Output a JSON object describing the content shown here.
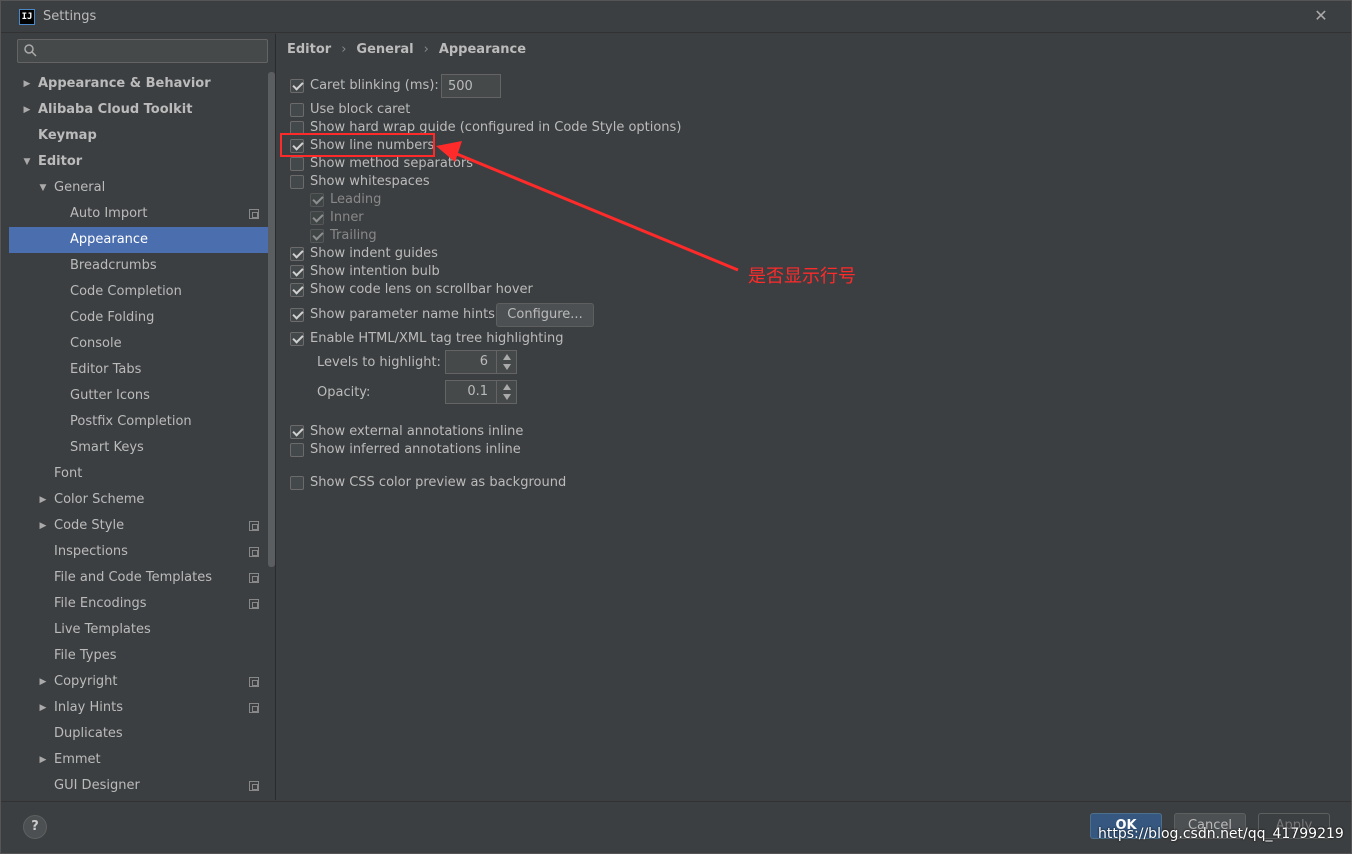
{
  "window": {
    "title": "Settings",
    "app_icon_text": "IJ",
    "close_glyph": "✕"
  },
  "search": {
    "placeholder": "",
    "value": ""
  },
  "sidebar": {
    "items": [
      {
        "label": "Appearance & Behavior",
        "arrow": "▶",
        "copy": false
      },
      {
        "label": "Alibaba Cloud Toolkit",
        "arrow": "▶",
        "copy": false
      },
      {
        "label": "Keymap",
        "arrow": "",
        "copy": false
      },
      {
        "label": "Editor",
        "arrow": "▼",
        "copy": false
      },
      {
        "label": "General",
        "arrow": "▼",
        "copy": false
      },
      {
        "label": "Auto Import",
        "arrow": "",
        "copy": true
      },
      {
        "label": "Appearance",
        "arrow": "",
        "copy": false,
        "selected": true
      },
      {
        "label": "Breadcrumbs",
        "arrow": "",
        "copy": false
      },
      {
        "label": "Code Completion",
        "arrow": "",
        "copy": false
      },
      {
        "label": "Code Folding",
        "arrow": "",
        "copy": false
      },
      {
        "label": "Console",
        "arrow": "",
        "copy": false
      },
      {
        "label": "Editor Tabs",
        "arrow": "",
        "copy": false
      },
      {
        "label": "Gutter Icons",
        "arrow": "",
        "copy": false
      },
      {
        "label": "Postfix Completion",
        "arrow": "",
        "copy": false
      },
      {
        "label": "Smart Keys",
        "arrow": "",
        "copy": false
      },
      {
        "label": "Font",
        "arrow": "",
        "copy": false
      },
      {
        "label": "Color Scheme",
        "arrow": "▶",
        "copy": false
      },
      {
        "label": "Code Style",
        "arrow": "▶",
        "copy": true
      },
      {
        "label": "Inspections",
        "arrow": "",
        "copy": true
      },
      {
        "label": "File and Code Templates",
        "arrow": "",
        "copy": true
      },
      {
        "label": "File Encodings",
        "arrow": "",
        "copy": true
      },
      {
        "label": "Live Templates",
        "arrow": "",
        "copy": false
      },
      {
        "label": "File Types",
        "arrow": "",
        "copy": false
      },
      {
        "label": "Copyright",
        "arrow": "▶",
        "copy": true
      },
      {
        "label": "Inlay Hints",
        "arrow": "▶",
        "copy": true
      },
      {
        "label": "Duplicates",
        "arrow": "",
        "copy": false
      },
      {
        "label": "Emmet",
        "arrow": "▶",
        "copy": false
      },
      {
        "label": "GUI Designer",
        "arrow": "",
        "copy": true
      }
    ]
  },
  "breadcrumb": {
    "part1": "Editor",
    "part2": "General",
    "part3": "Appearance",
    "sep": "›"
  },
  "settings": {
    "caret_blinking": {
      "label": "Caret blinking (ms):",
      "checked": true,
      "value": "500"
    },
    "use_block_caret": {
      "label": "Use block caret",
      "checked": false
    },
    "show_hard_wrap": {
      "label": "Show hard wrap guide (configured in Code Style options)",
      "checked": false
    },
    "show_line_numbers": {
      "label": "Show line numbers",
      "checked": true
    },
    "show_method_separators": {
      "label": "Show method separators",
      "checked": false
    },
    "show_whitespaces": {
      "label": "Show whitespaces",
      "checked": false
    },
    "leading": {
      "label": "Leading",
      "checked": true
    },
    "inner": {
      "label": "Inner",
      "checked": true
    },
    "trailing": {
      "label": "Trailing",
      "checked": true
    },
    "show_indent_guides": {
      "label": "Show indent guides",
      "checked": true
    },
    "show_intention_bulb": {
      "label": "Show intention bulb",
      "checked": true
    },
    "show_code_lens": {
      "label": "Show code lens on scrollbar hover",
      "checked": true
    },
    "show_param_hints": {
      "label": "Show parameter name hints",
      "checked": true,
      "button": "Configure..."
    },
    "enable_html_xml": {
      "label": "Enable HTML/XML tag tree highlighting",
      "checked": true
    },
    "levels_to_highlight": {
      "label": "Levels to highlight:",
      "value": "6"
    },
    "opacity": {
      "label": "Opacity:",
      "value": "0.1"
    },
    "show_external_annotations": {
      "label": "Show external annotations inline",
      "checked": true
    },
    "show_inferred_annotations": {
      "label": "Show inferred annotations inline",
      "checked": false
    },
    "show_css_color": {
      "label": "Show CSS color preview as background",
      "checked": false
    }
  },
  "annotation": {
    "text": "是否显示行号",
    "color": "#ff2a2a"
  },
  "footer": {
    "help": "?",
    "ok": "OK",
    "cancel": "Cancel",
    "apply": "Apply"
  },
  "watermark": "https://blog.csdn.net/qq_41799219",
  "colors": {
    "background": "#3c3f41",
    "selection": "#4b6eaf",
    "ok_button": "#365880",
    "text": "#bbbbbb"
  }
}
